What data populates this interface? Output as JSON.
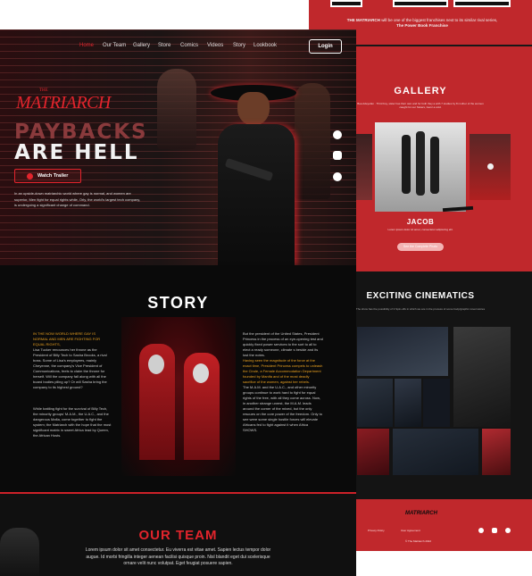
{
  "right": {
    "intro_brand": "THE MATRIARCH",
    "intro_text": "will be one of the biggest franchises next to its similar rival series,",
    "intro_link": "The Power Book Franchise",
    "gallery": {
      "title": "GALLERY",
      "subtitle": "Bea Adeyefan · Third boy, sister has their own and for both they a with 7 studies by 8 mother of the women caught for our Sisters, Genz a cold.",
      "character_name": "JACOB",
      "character_desc": "Lorem ipsum dolor sit amet, consectetur adipiscing elit.",
      "button": "See the Complete Photo"
    },
    "cinematics": {
      "title": "EXCITING CINEMATICS",
      "subtitle": "The show has the possibility of 3 Spin-offs in which we are in the process of some body/graphic novel stories"
    },
    "footer": {
      "logo": "MATRIARCH",
      "privacy": "Privacy Policy",
      "user_agreement": "User Agreement",
      "copyright": "© The Matriarch 2022"
    }
  },
  "hero": {
    "nav": [
      "Home",
      "Our Team",
      "Gallery",
      "Store",
      "Comics",
      "Videos",
      "Story",
      "Lookbook"
    ],
    "login": "Login",
    "logo_small": "THE",
    "logo_main": "MATRIARCH",
    "headline_1": "PAYBACKS",
    "headline_2": "ARE HELL",
    "watch_trailer": "Watch Trailer",
    "description": "In an upside-down matriarchic world where gay is normal, and women are superior, Men fight for equal rights while, Orly, the world's largest tech company, is undergoing a significant change of command."
  },
  "story": {
    "title": "STORY",
    "left_highlight": "IN THE NOW WORLD WHERE GAY IS NORMAL AND MEN ARE FIGHTING FOR EQUAL RIGHTS,",
    "left_text": "Lisa Tucker renounces her throne as the President of Billy Tech to Sasha Brooks, a rival boss. Some of Lisa's employees, mainly Cheyenne, the company's Vice President of Communications, feels to claim the throne for herself. Will the company fall along with all the board bodies piling up? Or will Sasha bring the company to its highest ground?",
    "left_text_2": "While battling fight for the survival of Billy Tech, the minority groups' M.A.M., the U.A.C., and the dangerous Mafia, come together to fight the system; the Matriarch with the hope that the most significant matrix in sweet Africa lead by Queen, the African Hosts.",
    "right_text_1": "But the president of the United States, President Princess in the process of an eye-opening test and quickly fixed power services to the sort to all to elect a ready someone, climate s beside and its lost the notes.",
    "right_highlight": "Having seen the magnitude of the force at the exact time, President Princess compels to unleash the Cirule, a Female Accommodation Department founded by Manifa and of the most deadly sacrifice of the women, against her rebels.",
    "right_text_2": "The M.A.M. and the U.A.C., and other minority groups continue to work hard to fight for equal rights of the free, with all they come across. Now, in another strange unrest, the M.A.M. leads around the corner of the mixed, but the only rescues on the core power of the freedom. Only to see were some single hostile forces will elevate Africans fed to fight against it when Africa SHOWS."
  },
  "team": {
    "title": "OUR TEAM",
    "text": "Lorem ipsum dolor sit amet consectetur. Eu viverra est vitae amet. Sapien lectus tempor dolor augue. Id morbi fringilla integer aenean facilisi quisque proin. Nisl blandit eget dui scelerisque ornare velit nunc volutpat. Eget feugiat posuere sapien."
  },
  "colors": {
    "accent_red": "#c0282c",
    "bright_red": "#e2242c",
    "dark_bg": "#0c0c0c",
    "highlight_yellow": "#e8a020"
  },
  "icons": {
    "facebook": "facebook-icon",
    "instagram": "instagram-icon",
    "linkedin": "linkedin-icon",
    "play": "play-icon"
  }
}
